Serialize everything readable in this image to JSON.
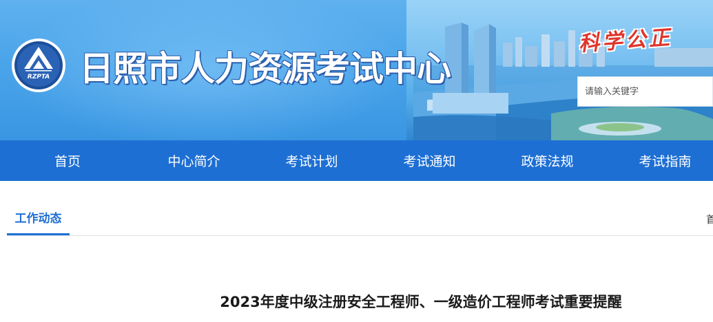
{
  "header": {
    "logo_text": "RZPTA",
    "site_title": "日照市人力资源考试中心",
    "slogan": "科学公正",
    "search": {
      "placeholder": "请输入关键字",
      "value": ""
    }
  },
  "nav": {
    "items": [
      {
        "label": "首页"
      },
      {
        "label": "中心简介"
      },
      {
        "label": "考试计划"
      },
      {
        "label": "考试通知"
      },
      {
        "label": "政策法规"
      },
      {
        "label": "考试指南"
      }
    ]
  },
  "section": {
    "active_tab": "工作动态",
    "breadcrumb_start": "首"
  },
  "article": {
    "title": "2023年度中级注册安全工程师、一级造价工程师考试重要提醒"
  },
  "colors": {
    "nav_bg": "#1e6fd3",
    "accent": "#1e6fd3",
    "slogan": "#e0352b"
  }
}
